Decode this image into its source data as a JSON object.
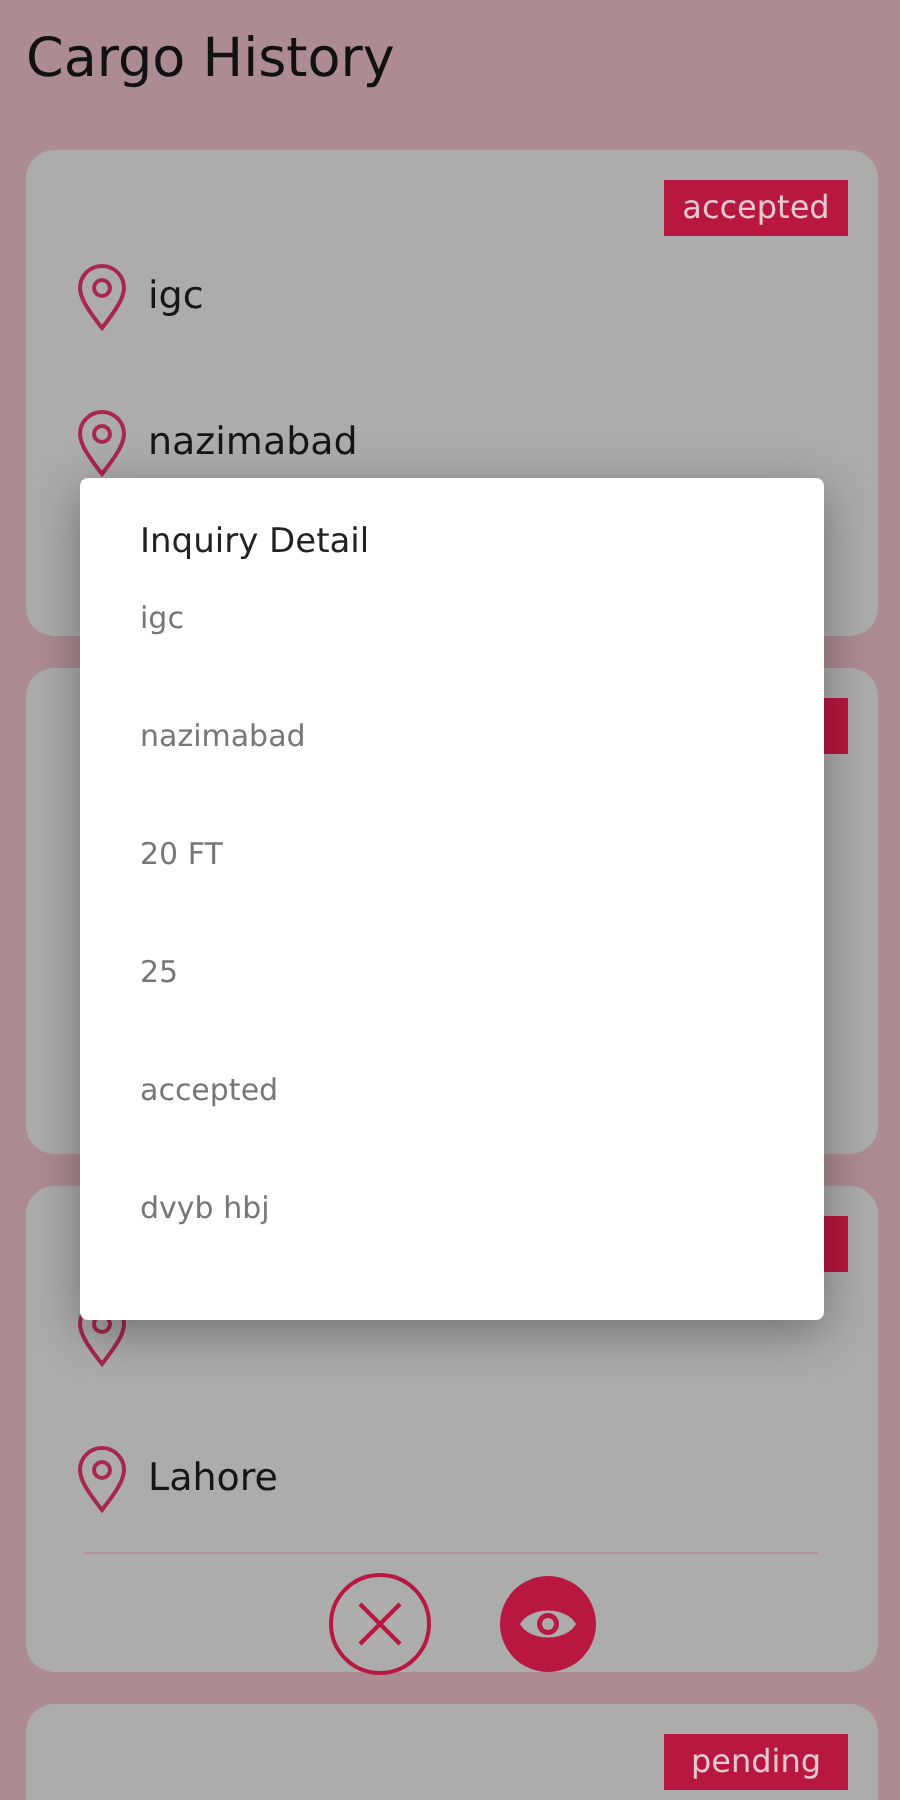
{
  "screen": {
    "title": "Cargo History"
  },
  "cards": [
    {
      "badge_visible": true,
      "status": "accepted",
      "locations": [
        {
          "kind": "place",
          "place": "igc"
        },
        {
          "kind": "place",
          "place": "nazimabad"
        }
      ]
    },
    {
      "badge_visible": true
    },
    {
      "badge_visible": true,
      "locations": [
        {
          "kind": "pin"
        },
        {
          "kind": "place",
          "place": "Lahore"
        }
      ],
      "actions": [
        {
          "kind": "cancel"
        },
        {
          "kind": "view"
        }
      ]
    },
    {
      "badge_visible": true,
      "status": "pending"
    }
  ],
  "dialog": {
    "title": "Inquiry Detail",
    "lines": [
      "igc",
      "nazimabad",
      "20 FT",
      "25",
      "accepted",
      "dvyb hbj"
    ]
  }
}
